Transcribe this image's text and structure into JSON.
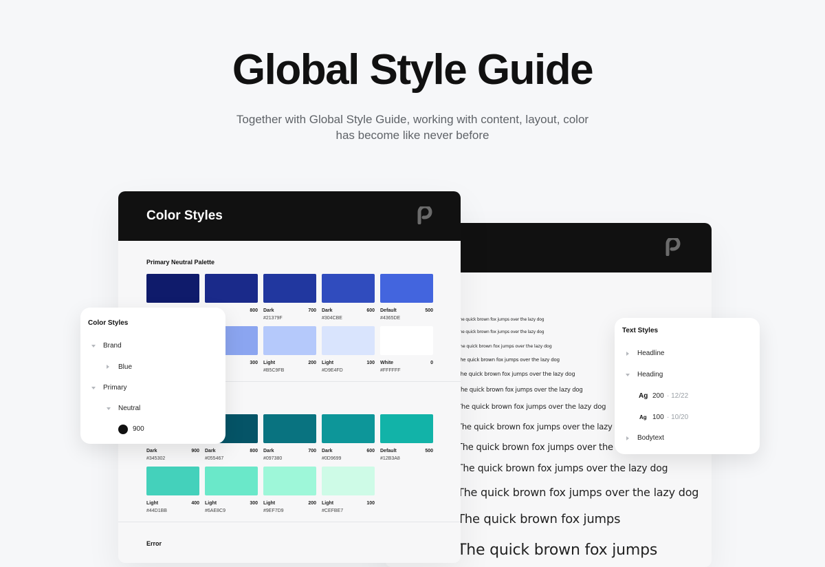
{
  "hero": {
    "title": "Global Style Guide",
    "subtitle": "Together with Global Style Guide, working with content, layout, color has become like never before"
  },
  "color_card": {
    "title": "Color Styles",
    "logo_icon": "brand-p-logo-icon",
    "sections": {
      "primary_label": "Primary Neutral Palette",
      "error_label": "Error"
    },
    "blue_row1": [
      {
        "color": "#0F1B6B",
        "name": "",
        "value": "",
        "hex": ""
      },
      {
        "color": "#1A2A8A",
        "name": "",
        "value": "800",
        "hex": ""
      },
      {
        "color": "#21379F",
        "name": "Dark",
        "value": "700",
        "hex": "#21379F"
      },
      {
        "color": "#304CBE",
        "name": "Dark",
        "value": "600",
        "hex": "#304CBE"
      },
      {
        "color": "#4365DE",
        "name": "Default",
        "value": "500",
        "hex": "#4365DE"
      }
    ],
    "blue_row2": [
      {
        "color": "#8BA5F0",
        "name": "",
        "value": "300",
        "hex": ""
      },
      {
        "color": "#B5C9FB",
        "name": "Light",
        "value": "200",
        "hex": "#B5C9FB"
      },
      {
        "color": "#D9E4FD",
        "name": "Light",
        "value": "100",
        "hex": "#D9E4FD"
      },
      {
        "color": "#FFFFFF",
        "name": "White",
        "value": "0",
        "hex": "#FFFFFF"
      }
    ],
    "teal_row1": [
      {
        "color": "#345302",
        "name": "Dark",
        "value": "900",
        "hex": "#345302"
      },
      {
        "color": "#055467",
        "name": "Dark",
        "value": "800",
        "hex": "#055467"
      },
      {
        "color": "#097380",
        "name": "Dark",
        "value": "700",
        "hex": "#097380"
      },
      {
        "color": "#0D9699",
        "name": "Dark",
        "value": "600",
        "hex": "#0D9699"
      },
      {
        "color": "#12B3A8",
        "name": "Default",
        "value": "500",
        "hex": "#12B3A8"
      }
    ],
    "teal_row2": [
      {
        "color": "#44D1BB",
        "name": "Light",
        "value": "400",
        "hex": "#44D1BB"
      },
      {
        "color": "#6AE8C9",
        "name": "Light",
        "value": "300",
        "hex": "#6AE8C9"
      },
      {
        "color": "#9EF7D9",
        "name": "Light",
        "value": "200",
        "hex": "#9EF7D9"
      },
      {
        "color": "#CEFBE7",
        "name": "Light",
        "value": "100",
        "hex": "#CEFBE7"
      }
    ]
  },
  "type_card": {
    "logo_icon": "brand-p-logo-icon",
    "sample_text_long": "The quick brown fox jumps over the lazy dog",
    "sample_text_short": "The quick brown fox jumps"
  },
  "color_panel": {
    "title": "Color Styles",
    "items": {
      "brand": "Brand",
      "blue": "Blue",
      "primary": "Primary",
      "neutral": "Neutral",
      "shade": "900"
    }
  },
  "text_panel": {
    "title": "Text Styles",
    "items": {
      "headline": "Headline",
      "heading": "Heading",
      "ag1": "Ag",
      "size1": "200",
      "lh1": "· 12/22",
      "ag2": "Ag",
      "size2": "100",
      "lh2": "· 10/20",
      "bodytext": "Bodytext"
    }
  }
}
